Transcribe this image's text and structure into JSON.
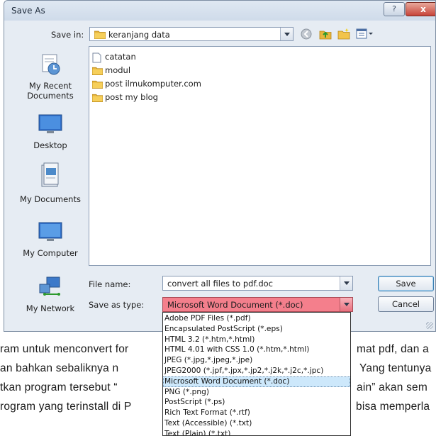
{
  "dialog": {
    "title": "Save As",
    "help": "?",
    "close": "x",
    "save_in_label": "Save in:",
    "save_in_value": "keranjang data",
    "filename_label": "File name:",
    "filename_value": "convert all files to pdf.doc",
    "savetype_label": "Save as type:",
    "savetype_value": "Microsoft Word Document (*.doc)",
    "save_button": "Save",
    "cancel_button": "Cancel"
  },
  "places": [
    {
      "label": "My Recent\nDocuments",
      "icon": "recent-documents-icon"
    },
    {
      "label": "Desktop",
      "icon": "desktop-icon"
    },
    {
      "label": "My Documents",
      "icon": "my-documents-icon"
    },
    {
      "label": "My Computer",
      "icon": "my-computer-icon"
    },
    {
      "label": "My Network",
      "icon": "my-network-icon"
    }
  ],
  "files": [
    {
      "name": "catatan",
      "icon": "document-icon"
    },
    {
      "name": "modul",
      "icon": "folder-icon"
    },
    {
      "name": "post ilmukomputer.com",
      "icon": "folder-icon"
    },
    {
      "name": "post my blog",
      "icon": "folder-icon"
    }
  ],
  "type_options": [
    "Adobe PDF Files (*.pdf)",
    "Encapsulated PostScript (*.eps)",
    "HTML 3.2 (*.htm,*.html)",
    "HTML 4.01 with CSS 1.0 (*.htm,*.html)",
    "JPEG (*.jpg,*.jpeg,*.jpe)",
    "JPEG2000 (*.jpf,*.jpx,*.jp2,*.j2k,*.j2c,*.jpc)",
    "Microsoft Word Document (*.doc)",
    "PNG (*.png)",
    "PostScript (*.ps)",
    "Rich Text Format (*.rtf)",
    "Text (Accessible) (*.txt)",
    "Text (Plain) (*.txt)"
  ],
  "selected_option_index": 6,
  "background_text": [
    "ram untuk menconvert for",
    "an bahkan sebaliknya n",
    "tkan program tersebut “",
    "rogram yang terinstall di P",
    "mat pdf, dan a",
    "Yang tentunya",
    "ain” akan sem",
    "bisa memperla"
  ],
  "colors": {
    "highlight": "#f47f8c",
    "selection": "#cde8fb",
    "dialog_bg": "#e6ecf3"
  }
}
